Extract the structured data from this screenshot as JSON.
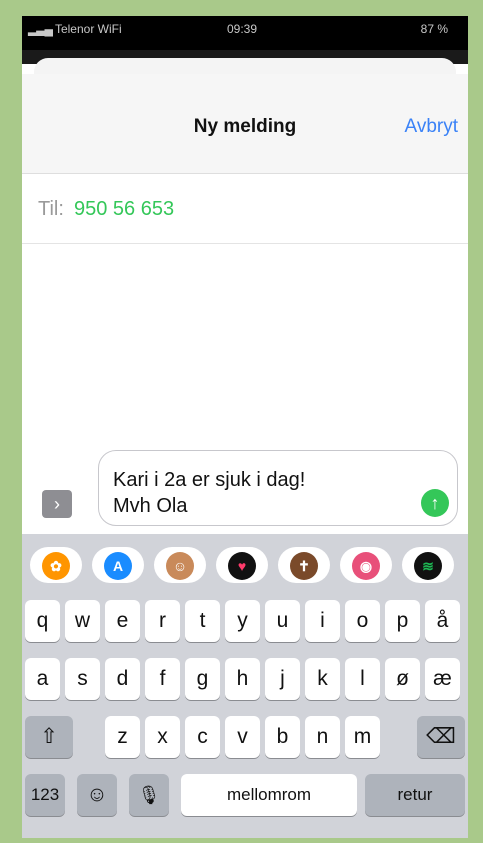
{
  "status": {
    "carrier": "Telenor WiFi",
    "time": "09:39",
    "battery": "87 %"
  },
  "header": {
    "title": "Ny melding",
    "cancel_label": "Avbryt"
  },
  "recipient": {
    "label": "Til:",
    "number": "950 56 653"
  },
  "message": {
    "text": "Kari i 2a er sjuk i dag!\nMvh Ola",
    "expand_icon": "chevron-right-icon",
    "send_icon": "arrow-up-icon"
  },
  "apps": [
    {
      "name": "photos",
      "icon": "photos-icon",
      "glyph": "✿",
      "color": "#ff9500"
    },
    {
      "name": "app-store",
      "icon": "app-store-icon",
      "glyph": "A",
      "color": "#1a8cff"
    },
    {
      "name": "memoji",
      "icon": "memoji-icon",
      "glyph": "☺",
      "color": "#c98a5a"
    },
    {
      "name": "digital-touch",
      "icon": "heart-icon",
      "glyph": "♥",
      "color": "#111111"
    },
    {
      "name": "holy-bible",
      "icon": "bible-icon",
      "glyph": "✝",
      "color": "#7a4a2a"
    },
    {
      "name": "photo-collage",
      "icon": "camera-app-icon",
      "glyph": "◉",
      "color": "#e8507a"
    },
    {
      "name": "spotify",
      "icon": "spotify-icon",
      "glyph": "≋",
      "color": "#111111"
    }
  ],
  "keyboard": {
    "row1": [
      "q",
      "w",
      "e",
      "r",
      "t",
      "y",
      "u",
      "i",
      "o",
      "p",
      "å"
    ],
    "row2": [
      "a",
      "s",
      "d",
      "f",
      "g",
      "h",
      "j",
      "k",
      "l",
      "ø",
      "æ"
    ],
    "row3": [
      "z",
      "x",
      "c",
      "v",
      "b",
      "n",
      "m"
    ],
    "shift_icon": "shift-icon",
    "shift_glyph": "⇧",
    "backspace_icon": "backspace-icon",
    "backspace_glyph": "⌫",
    "numbers_label": "123",
    "emoji_icon": "emoji-icon",
    "emoji_glyph": "☺",
    "mic_icon": "microphone-icon",
    "mic_glyph": "🎙",
    "space_label": "mellomrom",
    "return_label": "retur"
  }
}
